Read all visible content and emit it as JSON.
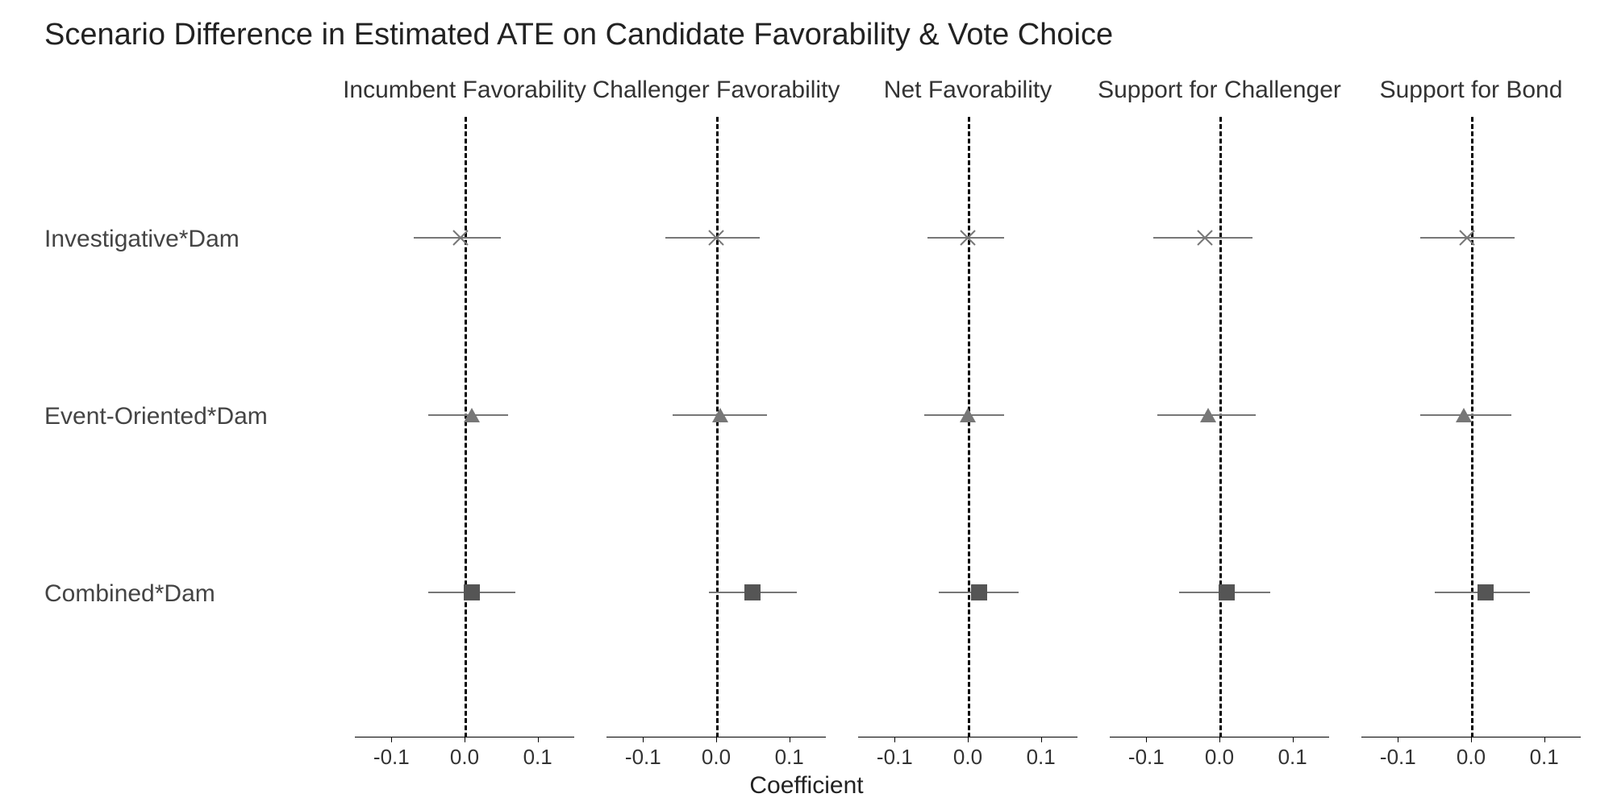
{
  "title": "Scenario Difference in Estimated ATE on Candidate Favorability & Vote Choice",
  "xlabel": "Coefficient",
  "xticks": [
    "-0.1",
    "0.0",
    "0.1"
  ],
  "rows": [
    {
      "label": "Investigative*Dam",
      "marker": "x"
    },
    {
      "label": "Event-Oriented*Dam",
      "marker": "triangle"
    },
    {
      "label": "Combined*Dam",
      "marker": "square"
    }
  ],
  "panels": [
    "Incumbent Favorability",
    "Challenger Favorability",
    "Net Favorability",
    "Support for Challenger",
    "Support for Bond"
  ],
  "chart_data": {
    "type": "scatter",
    "title": "Scenario Difference in Estimated ATE on Candidate Favorability & Vote Choice",
    "xlabel": "Coefficient",
    "ylabel": "",
    "xlim": [
      -0.15,
      0.15
    ],
    "x_ticks": [
      -0.1,
      0.0,
      0.1
    ],
    "y_categories": [
      "Investigative*Dam",
      "Event-Oriented*Dam",
      "Combined*Dam"
    ],
    "ref_line_x": 0,
    "facets": [
      {
        "name": "Incumbent Favorability",
        "points": [
          {
            "y": "Investigative*Dam",
            "estimate": -0.005,
            "ci_lo": -0.07,
            "ci_hi": 0.05,
            "shape": "x"
          },
          {
            "y": "Event-Oriented*Dam",
            "estimate": 0.01,
            "ci_lo": -0.05,
            "ci_hi": 0.06,
            "shape": "triangle"
          },
          {
            "y": "Combined*Dam",
            "estimate": 0.01,
            "ci_lo": -0.05,
            "ci_hi": 0.07,
            "shape": "square"
          }
        ]
      },
      {
        "name": "Challenger Favorability",
        "points": [
          {
            "y": "Investigative*Dam",
            "estimate": 0.0,
            "ci_lo": -0.07,
            "ci_hi": 0.06,
            "shape": "x"
          },
          {
            "y": "Event-Oriented*Dam",
            "estimate": 0.005,
            "ci_lo": -0.06,
            "ci_hi": 0.07,
            "shape": "triangle"
          },
          {
            "y": "Combined*Dam",
            "estimate": 0.05,
            "ci_lo": -0.01,
            "ci_hi": 0.11,
            "shape": "square"
          }
        ]
      },
      {
        "name": "Net Favorability",
        "points": [
          {
            "y": "Investigative*Dam",
            "estimate": 0.0,
            "ci_lo": -0.055,
            "ci_hi": 0.05,
            "shape": "x"
          },
          {
            "y": "Event-Oriented*Dam",
            "estimate": 0.0,
            "ci_lo": -0.06,
            "ci_hi": 0.05,
            "shape": "triangle"
          },
          {
            "y": "Combined*Dam",
            "estimate": 0.015,
            "ci_lo": -0.04,
            "ci_hi": 0.07,
            "shape": "square"
          }
        ]
      },
      {
        "name": "Support for Challenger",
        "points": [
          {
            "y": "Investigative*Dam",
            "estimate": -0.02,
            "ci_lo": -0.09,
            "ci_hi": 0.045,
            "shape": "x"
          },
          {
            "y": "Event-Oriented*Dam",
            "estimate": -0.015,
            "ci_lo": -0.085,
            "ci_hi": 0.05,
            "shape": "triangle"
          },
          {
            "y": "Combined*Dam",
            "estimate": 0.01,
            "ci_lo": -0.055,
            "ci_hi": 0.07,
            "shape": "square"
          }
        ]
      },
      {
        "name": "Support for Bond",
        "points": [
          {
            "y": "Investigative*Dam",
            "estimate": -0.005,
            "ci_lo": -0.07,
            "ci_hi": 0.06,
            "shape": "x"
          },
          {
            "y": "Event-Oriented*Dam",
            "estimate": -0.01,
            "ci_lo": -0.07,
            "ci_hi": 0.055,
            "shape": "triangle"
          },
          {
            "y": "Combined*Dam",
            "estimate": 0.02,
            "ci_lo": -0.05,
            "ci_hi": 0.08,
            "shape": "square"
          }
        ]
      }
    ]
  }
}
